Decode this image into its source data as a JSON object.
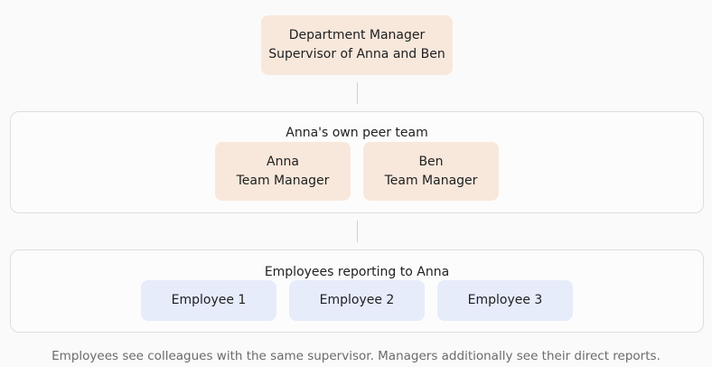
{
  "colors": {
    "manager_fill": "#f8e8dc",
    "employee_fill": "#e6ecfa",
    "group_border": "#dedede",
    "connector": "#cfcfcf",
    "caption_text": "#6b6b6b"
  },
  "top_node": {
    "title": "Department Manager",
    "subtitle": "Supervisor of Anna and Ben"
  },
  "peer_group": {
    "title": "Anna's own peer team",
    "members": [
      {
        "name": "Anna",
        "role": "Team Manager"
      },
      {
        "name": "Ben",
        "role": "Team Manager"
      }
    ]
  },
  "reports_group": {
    "title": "Employees reporting to Anna",
    "members": [
      {
        "name": "Employee 1"
      },
      {
        "name": "Employee 2"
      },
      {
        "name": "Employee 3"
      }
    ]
  },
  "caption": "Employees see colleagues with the same supervisor. Managers additionally see their direct reports."
}
